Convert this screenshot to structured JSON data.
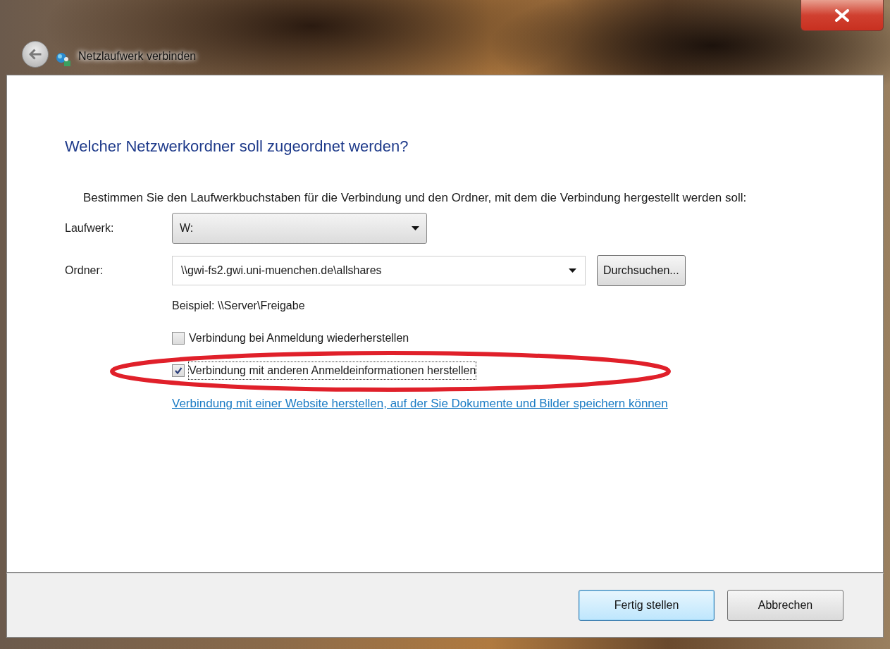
{
  "window": {
    "title": "Netzlaufwerk verbinden"
  },
  "heading": "Welcher Netzwerkordner soll zugeordnet werden?",
  "description": "Bestimmen Sie den Laufwerkbuchstaben für die Verbindung und den Ordner, mit dem die Verbindung hergestellt werden soll:",
  "drive": {
    "label": "Laufwerk:",
    "value": "W:"
  },
  "folder": {
    "label": "Ordner:",
    "value": "\\\\gwi-fs2.gwi.uni-muenchen.de\\allshares",
    "browse_button": "Durchsuchen..."
  },
  "example": "Beispiel: \\\\Server\\Freigabe",
  "options": [
    {
      "label": "Verbindung bei Anmeldung wiederherstellen",
      "checked": false,
      "focused": false
    },
    {
      "label": "Verbindung mit anderen Anmeldeinformationen herstellen",
      "checked": true,
      "focused": true
    }
  ],
  "link": "Verbindung mit einer Website herstellen, auf der Sie Dokumente und Bilder speichern können",
  "buttons": [
    {
      "label": "Fertig stellen",
      "default": true
    },
    {
      "label": "Abbrechen",
      "default": false
    }
  ]
}
